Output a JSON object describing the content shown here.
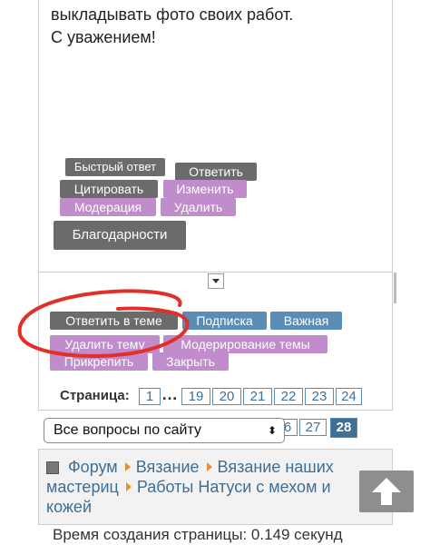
{
  "post": {
    "line1": "выкладывать фото своих работ.",
    "line2": "С уважением!"
  },
  "post_buttons": {
    "quick_reply": "Быстрый ответ",
    "reply": "Ответить",
    "quote": "Цитировать",
    "edit": "Изменить",
    "moderation": "Модерация",
    "delete": "Удалить",
    "thanks": "Благодарности"
  },
  "topic_buttons": {
    "reply_in_topic": "Ответить в теме",
    "subscribe": "Подписка",
    "important": "Важная",
    "delete_topic": "Удалить тему",
    "moderate_topic": "Модерирование темы",
    "pin": "Прикрепить",
    "close": "Закрыть"
  },
  "pagination": {
    "label": "Страница:",
    "first": "1",
    "dots": "…",
    "pages": [
      "19",
      "20",
      "21",
      "22",
      "23",
      "24"
    ],
    "pages_row2": [
      "6",
      "27"
    ],
    "current": "28"
  },
  "jump_select": {
    "selected": "Все вопросы по сайту"
  },
  "breadcrumb": {
    "forum": "Форум",
    "knitting": "Вязание",
    "masters_knitting_1": "Вязание наших",
    "masters_knitting_2": "мастериц",
    "topic_1": "Работы Натуси с мехом и",
    "topic_2": "кожей"
  },
  "footer": {
    "render_time": "Время создания страницы: 0.149 секунд"
  },
  "colors": {
    "dark_button": "#6b6b6b",
    "purple_button": "#c08ccc",
    "blue_button": "#5a8db5",
    "link": "#3f6f95",
    "annotation_red": "#e0302a"
  }
}
